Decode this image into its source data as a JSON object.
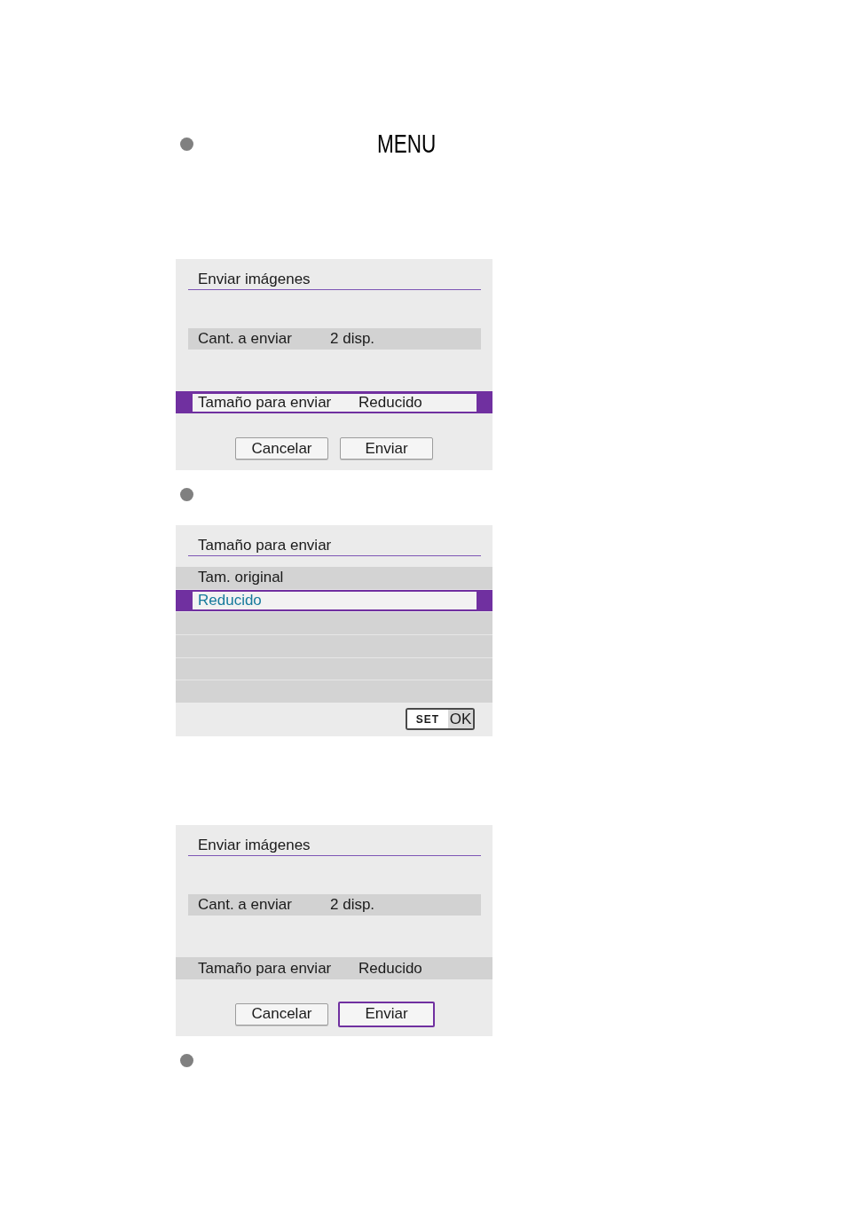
{
  "content": [
    {
      "kind": "bullet",
      "button_label": "MENU"
    },
    {
      "kind": "dialog_screen",
      "title": "Enviar imágenes",
      "rows": [
        {
          "kind": "info",
          "label": "Cant. a enviar",
          "value": "2 disp.",
          "selected": false
        },
        {
          "kind": "option",
          "label": "Tamaño para enviar",
          "value": "Reducido",
          "selected": true
        }
      ],
      "buttons": [
        {
          "label": "Cancelar",
          "selected": false
        },
        {
          "label": "Enviar",
          "selected": false
        }
      ]
    },
    {
      "kind": "bullet"
    },
    {
      "kind": "list_screen",
      "title": "Tamaño para enviar",
      "options": [
        {
          "label": "Tam. original",
          "selected": false
        },
        {
          "label": "Reducido",
          "selected": true
        }
      ],
      "confirm": {
        "key": "SET",
        "label": "OK"
      }
    },
    {
      "kind": "dialog_screen",
      "title": "Enviar imágenes",
      "rows": [
        {
          "kind": "info",
          "label": "Cant. a enviar",
          "value": "2 disp.",
          "selected": false
        },
        {
          "kind": "option",
          "label": "Tamaño para enviar",
          "value": "Reducido",
          "selected": false
        }
      ],
      "buttons": [
        {
          "label": "Cancelar",
          "selected": false
        },
        {
          "label": "Enviar",
          "selected": true
        }
      ]
    },
    {
      "kind": "bullet"
    }
  ]
}
